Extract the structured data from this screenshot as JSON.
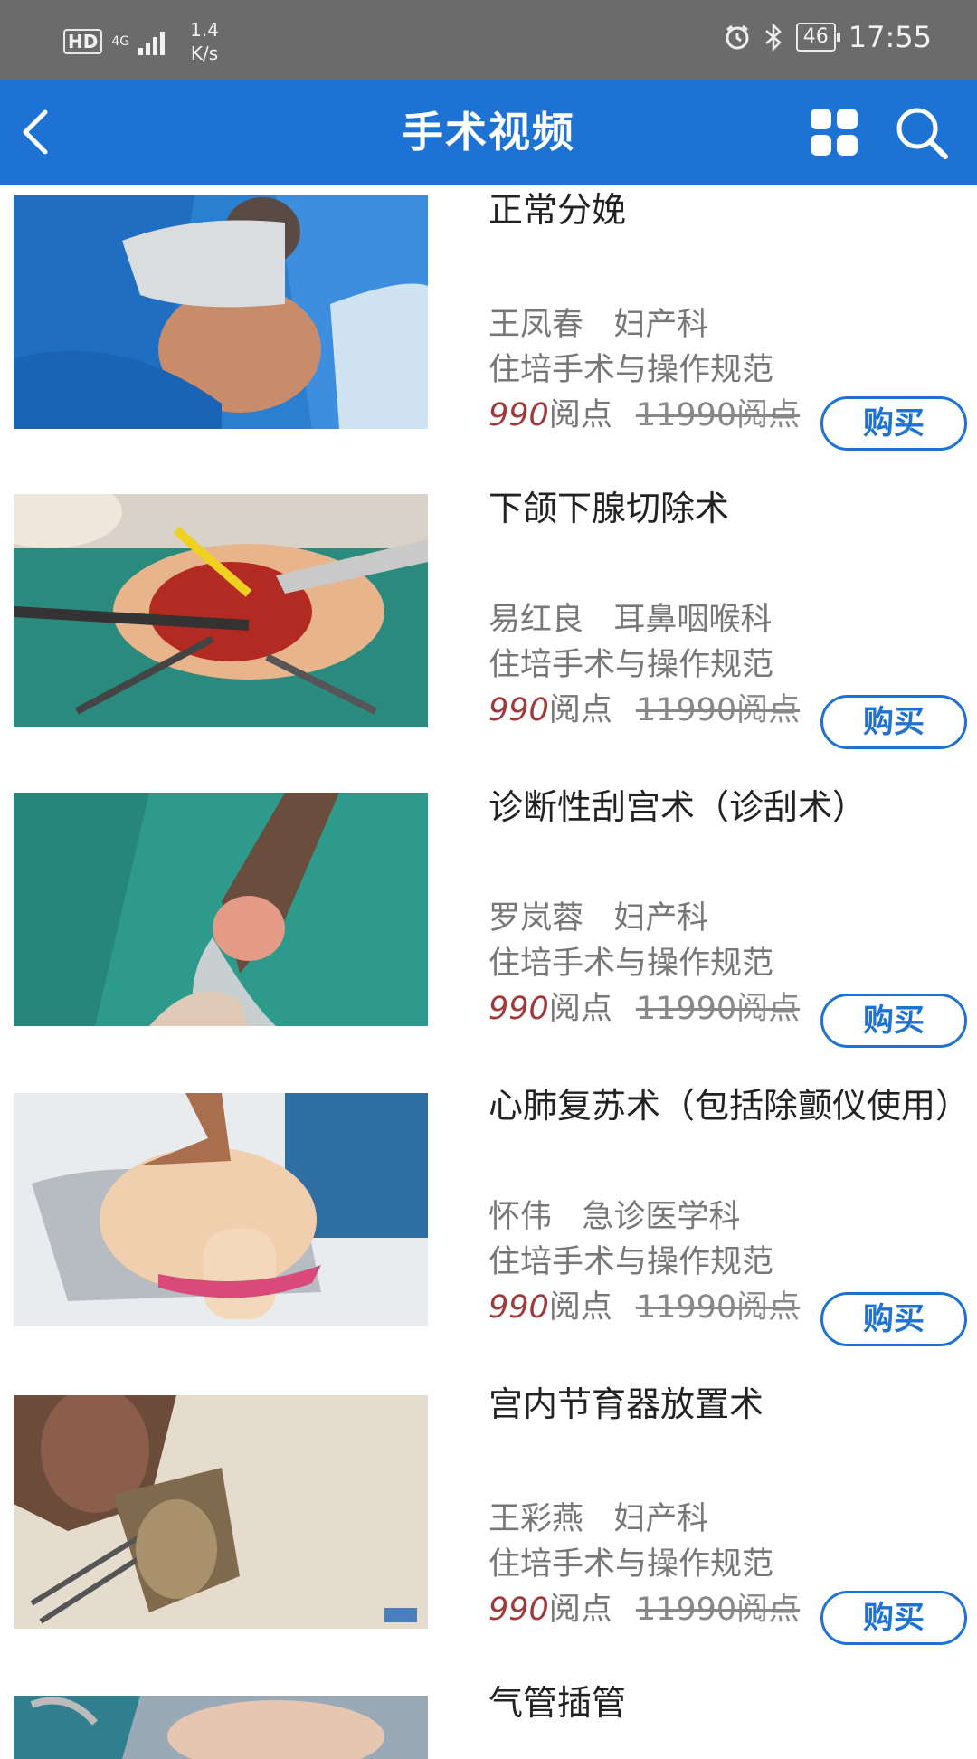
{
  "status_bar": {
    "hd": "HD",
    "network": "4G",
    "speed_value": "1.4",
    "speed_unit": "K/s",
    "battery": "46",
    "time": "17:55",
    "icons": [
      "alarm-icon",
      "bluetooth-icon"
    ]
  },
  "app_bar": {
    "title": "手术视频",
    "back_icon": "chevron-left-icon",
    "grid_icon": "grid-icon",
    "search_icon": "search-icon",
    "color": "#1d72d3"
  },
  "videos": [
    {
      "title": "正常分娩",
      "author": "王凤春",
      "dept": "妇产科",
      "category": "住培手术与操作规范",
      "price": "990",
      "unit": "阅点",
      "orig": "11990阅点",
      "buy": "购买"
    },
    {
      "title": "下颌下腺切除术",
      "author": "易红良",
      "dept": "耳鼻咽喉科",
      "category": "住培手术与操作规范",
      "price": "990",
      "unit": "阅点",
      "orig": "11990阅点",
      "buy": "购买"
    },
    {
      "title": "诊断性刮宫术（诊刮术）",
      "author": "罗岚蓉",
      "dept": "妇产科",
      "category": "住培手术与操作规范",
      "price": "990",
      "unit": "阅点",
      "orig": "11990阅点",
      "buy": "购买"
    },
    {
      "title": "心肺复苏术（包括除颤仪使用）",
      "author": "怀伟",
      "dept": "急诊医学科",
      "category": "住培手术与操作规范",
      "price": "990",
      "unit": "阅点",
      "orig": "11990阅点",
      "buy": "购买"
    },
    {
      "title": "宫内节育器放置术",
      "author": "王彩燕",
      "dept": "妇产科",
      "category": "住培手术与操作规范",
      "price": "990",
      "unit": "阅点",
      "orig": "11990阅点",
      "buy": "购买"
    },
    {
      "title": "气管插管"
    }
  ],
  "colors": {
    "price": "#a03a3a",
    "accent": "#1d72d3"
  }
}
